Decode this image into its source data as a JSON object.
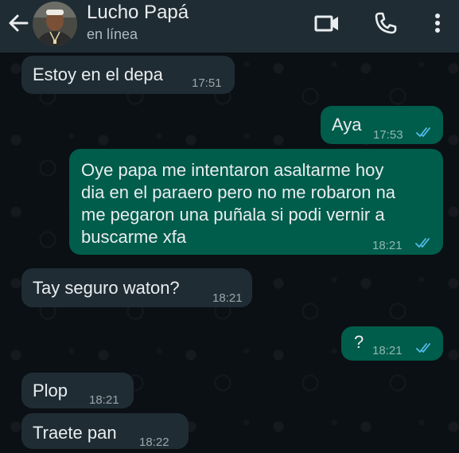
{
  "header": {
    "contact_name": "Lucho Papá",
    "status": "en línea",
    "background_color": "#1f2c34",
    "icons": [
      "back-arrow-icon",
      "video-call-icon",
      "voice-call-icon",
      "more-options-icon"
    ]
  },
  "messages": [
    {
      "direction": "in",
      "text": "Estoy en el depa",
      "time": "17:51"
    },
    {
      "direction": "out",
      "text": "Aya",
      "time": "17:53",
      "status": "read"
    },
    {
      "direction": "out",
      "lines": [
        "Oye papa me intentaron asaltarme hoy",
        "dia en el paraero pero no me robaron na",
        "me pegaron una puñala si podi vernir a",
        "buscarme xfa"
      ],
      "time": "18:21",
      "status": "read"
    },
    {
      "direction": "in",
      "text": "Tay seguro waton?",
      "time": "18:21"
    },
    {
      "direction": "out",
      "text": "?",
      "time": "18:21",
      "status": "read"
    },
    {
      "direction": "in",
      "text": "Plop",
      "time": "18:21"
    },
    {
      "direction": "in",
      "text": "Traete pan",
      "time": "18:22"
    }
  ],
  "colors": {
    "incoming_bubble": "#1f2c34",
    "outgoing_bubble": "#005c4b",
    "read_ticks": "#53bdeb",
    "chat_background": "#0b1014"
  }
}
